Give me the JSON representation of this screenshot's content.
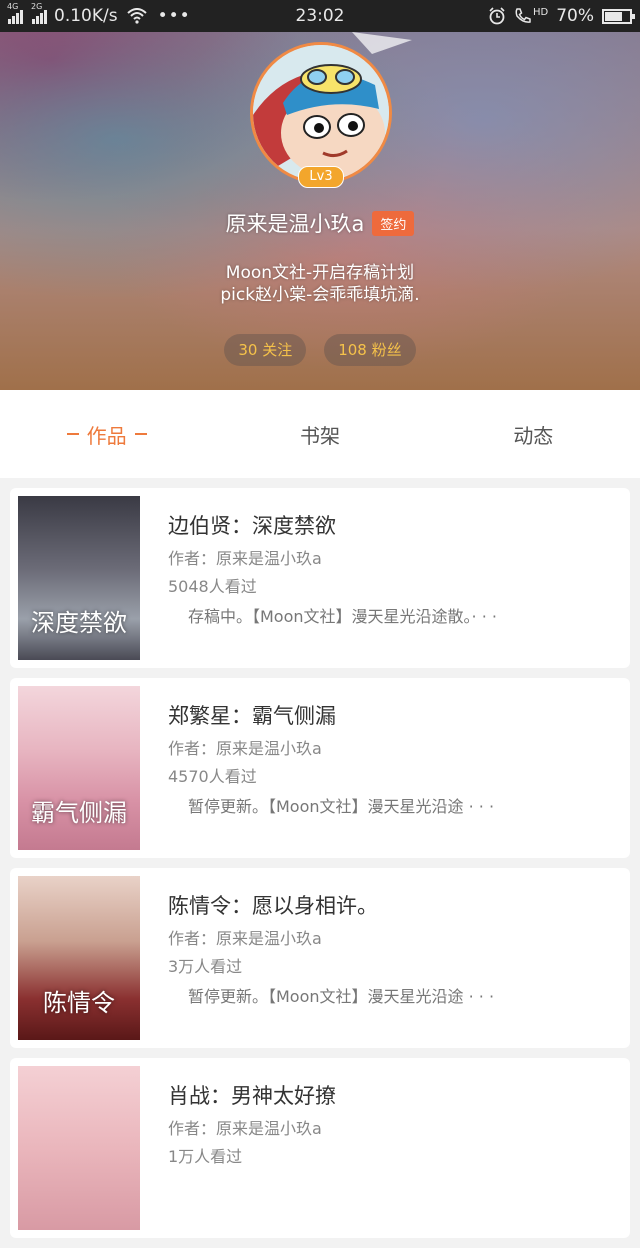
{
  "status_bar": {
    "net_tag_1": "4G",
    "net_tag_2": "2G",
    "speed": "0.10K/s",
    "more": "•••",
    "time": "23:02",
    "hd": "HD",
    "battery": "70%",
    "battery_level": 0.7
  },
  "profile": {
    "level": "Lv3",
    "username": "原来是温小玖a",
    "badge": "签约",
    "bio_line1": "Moon文社-开启存稿计划",
    "bio_line2": "pick赵小棠-会乖乖填坑滴.",
    "following": "30 关注",
    "followers": "108 粉丝"
  },
  "tabs": [
    "作品",
    "书架",
    "动态"
  ],
  "books": [
    {
      "cover_text": "深度禁欲",
      "title": "边伯贤：深度禁欲",
      "author": "作者：原来是温小玖a",
      "views": "5048人看过",
      "summary": "存稿中。【Moon文社】漫天星光沿途散。· · ·"
    },
    {
      "cover_text": "霸气侧漏",
      "title": "郑繁星：霸气侧漏",
      "author": "作者：原来是温小玖a",
      "views": "4570人看过",
      "summary": "暂停更新。【Moon文社】漫天星光沿途 · · ·"
    },
    {
      "cover_text": "陈情令",
      "title": "陈情令：愿以身相许。",
      "author": "作者：原来是温小玖a",
      "views": "3万人看过",
      "summary": "暂停更新。【Moon文社】漫天星光沿途 · · ·"
    },
    {
      "cover_text": "",
      "title": "肖战：男神太好撩",
      "author": "作者：原来是温小玖a",
      "views": "1万人看过",
      "summary": ""
    }
  ],
  "colors": {
    "accent": "#ee7a3c",
    "badge": "#ee6a3c",
    "level": "#f3a62c",
    "pill_text": "#f5c24a"
  }
}
